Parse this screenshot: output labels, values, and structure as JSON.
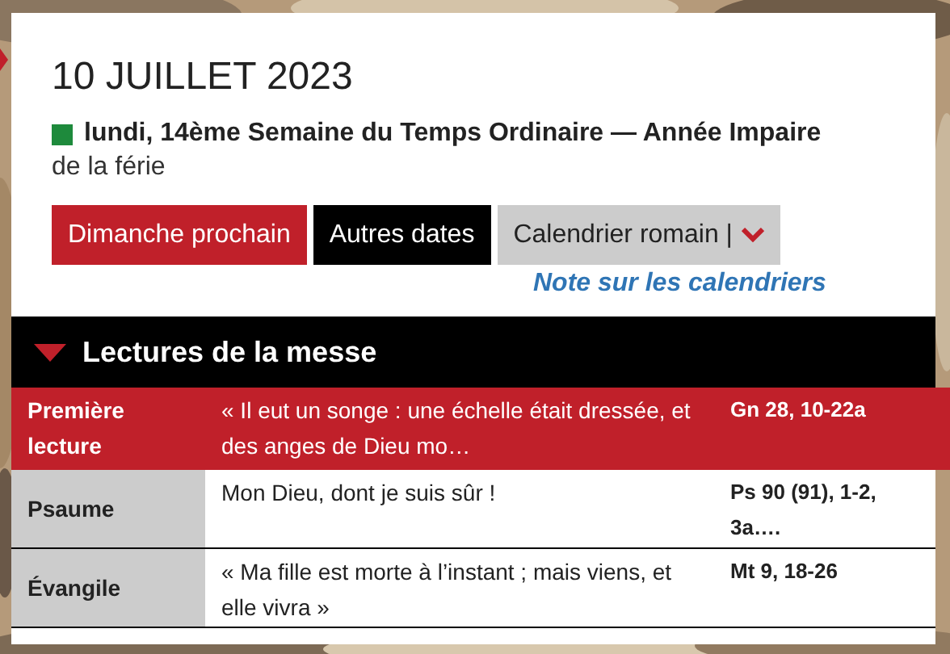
{
  "date_title": "10 JUILLET 2023",
  "day": {
    "color": "#1e8a3c",
    "label": "lundi, 14ème Semaine du Temps Ordinaire — Année Impaire",
    "subtitle": "de la férie"
  },
  "buttons": [
    {
      "label": "Dimanche prochain",
      "kind": "red"
    },
    {
      "label": "Autres dates",
      "kind": "black"
    },
    {
      "label": "Calendrier romain |",
      "kind": "dropdown"
    }
  ],
  "note_link": "Note sur les calendriers",
  "section": {
    "title": "Lectures de la messe",
    "expanded": true
  },
  "readings": [
    {
      "label": "Première lecture",
      "text": "« Il eut un songe : une échelle était dressée, et des anges de Dieu mo…",
      "reference": "Gn 28, 10-22a",
      "selected": true
    },
    {
      "label": "Psaume",
      "text": "Mon Dieu, dont je suis sûr !",
      "reference": "Ps 90 (91), 1-2, 3a….",
      "selected": false
    },
    {
      "label": "Évangile",
      "text": "« Ma fille est morte à l’instant ; mais viens, et elle vivra »",
      "reference": "Mt 9, 18-26",
      "selected": false
    }
  ]
}
